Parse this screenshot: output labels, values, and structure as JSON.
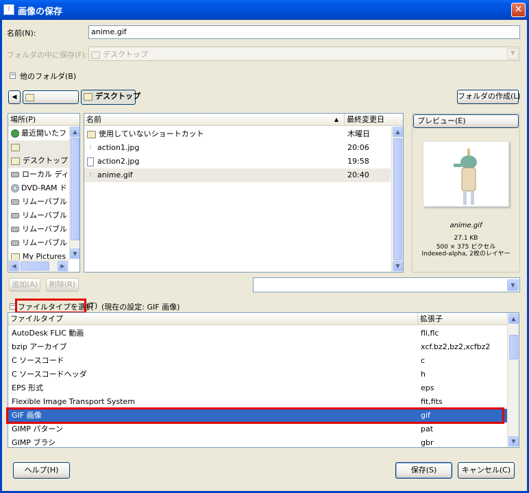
{
  "window": {
    "title": "画像の保存",
    "close_glyph": "✕"
  },
  "name_row": {
    "label": "名前(N):",
    "value": "anime.gif"
  },
  "folder_row": {
    "label": "フォルダの中に保存(F):",
    "value": "デスクトップ"
  },
  "other_folders": {
    "label": "他のフォルダ(B)",
    "toggle": "−"
  },
  "path_bar": {
    "back_glyph": "◀",
    "segments": [
      "",
      "デスクトップ"
    ],
    "create_folder_button": "フォルダの作成(L)"
  },
  "places": {
    "header": "場所(P)",
    "items": [
      {
        "label": "最近開いたフ",
        "icon": "recent-icon"
      },
      {
        "label": "",
        "icon": "folder-icon"
      },
      {
        "label": "デスクトップ",
        "icon": "folder-icon"
      },
      {
        "label": "ローカル ディス",
        "icon": "drive-icon"
      },
      {
        "label": "DVD-RAM ド",
        "icon": "dvd-icon"
      },
      {
        "label": "リムーバブル ラ",
        "icon": "drive-icon"
      },
      {
        "label": "リムーバブル ラ",
        "icon": "drive-icon"
      },
      {
        "label": "リムーバブル ラ",
        "icon": "drive-icon"
      },
      {
        "label": "リムーバブル ラ",
        "icon": "drive-icon"
      },
      {
        "label": "My Pictures",
        "icon": "folder-icon"
      }
    ],
    "add_button": "追加(A)",
    "remove_button": "削除(R)"
  },
  "files": {
    "columns": {
      "name": "名前",
      "modified": "最終変更日",
      "sort_glyph": "▲"
    },
    "rows": [
      {
        "name": "使用していないショートカット",
        "modified": "木曜日",
        "icon": "folder-icon"
      },
      {
        "name": "action1.jpg",
        "modified": "20:06",
        "icon": "image-file-icon"
      },
      {
        "name": "action2.jpg",
        "modified": "19:58",
        "icon": "file-icon"
      },
      {
        "name": "anime.gif",
        "modified": "20:40",
        "icon": "image-file-icon"
      }
    ]
  },
  "preview": {
    "button": "プレビュー(E)",
    "filename": "anime.gif",
    "size": "27.1 KB",
    "dimensions": "500 × 375 ピクセル",
    "mode": "Indexed-alpha, 2枚のレイヤー"
  },
  "filetype": {
    "toggle": "−",
    "select_label": "ファイルタイプを選択",
    "hotkey": "(T)",
    "current": "(現在の設定: GIF 画像)",
    "columns": {
      "type": "ファイルタイプ",
      "ext": "拡張子"
    },
    "rows": [
      {
        "type": "AutoDesk FLIC 動画",
        "ext": "fli,flc"
      },
      {
        "type": "bzip アーカイブ",
        "ext": "xcf.bz2,bz2,xcfbz2"
      },
      {
        "type": "C ソースコード",
        "ext": "c"
      },
      {
        "type": "C ソースコードヘッダ",
        "ext": "h"
      },
      {
        "type": "EPS 形式",
        "ext": "eps"
      },
      {
        "type": "Flexible Image Transport System",
        "ext": "fit,fits"
      },
      {
        "type": "GIF 画像",
        "ext": "gif"
      },
      {
        "type": "GIMP パターン",
        "ext": "pat"
      },
      {
        "type": "GIMP ブラシ",
        "ext": "gbr"
      }
    ],
    "selected_index": 6
  },
  "footer": {
    "help_button": "ヘルプ(H)",
    "save_button": "保存(S)",
    "cancel_button": "キャンセル(C)"
  },
  "colors": {
    "titlebar": "#0054e3",
    "selection": "#316ac5",
    "highlight_box": "#e00000"
  }
}
